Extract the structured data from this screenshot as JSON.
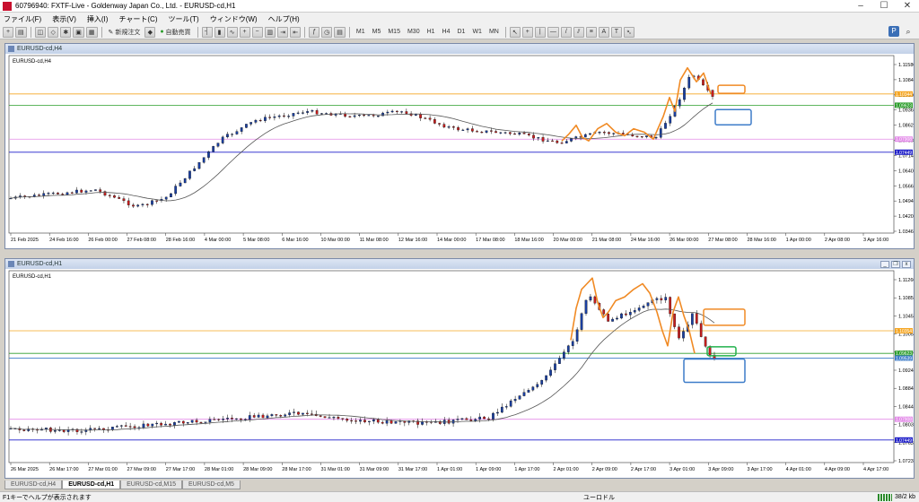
{
  "app": {
    "window_title": "60796940: FXTF-Live - Goldenway Japan Co., Ltd. - EURUSD-cd,H1"
  },
  "menu": [
    "ファイル(F)",
    "表示(V)",
    "挿入(I)",
    "チャート(C)",
    "ツール(T)",
    "ウィンドウ(W)",
    "ヘルプ(H)"
  ],
  "toolbar": {
    "new_order": "新規注文",
    "auto_trade": "自動売買",
    "timeframes": [
      "M1",
      "M5",
      "M15",
      "M30",
      "H1",
      "H4",
      "D1",
      "W1",
      "MN"
    ]
  },
  "colors": {
    "orange_line": "#f5a623",
    "violet_line": "#e38ce8",
    "blue_line": "#1f1fc9",
    "green_line": "#2a9d2a",
    "ma_line": "#555555",
    "bull": "#1a3fa0",
    "bear": "#c81e1e",
    "drawing_orange": "#f08a24",
    "drawing_blue": "#3d7cc9",
    "drawing_green": "#22b14c"
  },
  "chart_h4": {
    "window_label": "EURUSD-cd,H4",
    "symbol_label": "EURUSD-cd,H4",
    "price_labels": [
      "1.11580",
      "1.10840",
      "1.10100",
      "1.09360",
      "1.08620",
      "1.07880",
      "1.07140",
      "1.06400",
      "1.05660",
      "1.04940",
      "1.04200",
      "1.03460"
    ],
    "price_badges": {
      "orange": "1.10344",
      "green": "1.09623",
      "violet": "1.07908",
      "blue": "1.07449"
    },
    "time_labels": [
      "21 Feb 2025",
      "24 Feb 16:00",
      "26 Feb 00:00",
      "27 Feb 08:00",
      "28 Feb 16:00",
      "4 Mar 00:00",
      "5 Mar 08:00",
      "6 Mar 16:00",
      "10 Mar 00:00",
      "11 Mar 08:00",
      "12 Mar 16:00",
      "14 Mar 00:00",
      "17 Mar 08:00",
      "18 Mar 16:00",
      "20 Mar 00:00",
      "21 Mar 08:00",
      "24 Mar 16:00",
      "26 Mar 00:00",
      "27 Mar 08:00",
      "28 Mar 16:00",
      "1 Apr 00:00",
      "2 Apr 08:00",
      "3 Apr 16:00"
    ]
  },
  "chart_h1": {
    "window_label": "EURUSD-cd,H1",
    "symbol_label": "EURUSD-cd,H1",
    "price_labels": [
      "1.11260",
      "1.10850",
      "1.10450",
      "1.10050",
      "1.09640",
      "1.09240",
      "1.08840",
      "1.08440",
      "1.08030",
      "1.07630",
      "1.07230"
    ],
    "price_badges": {
      "orange": "1.10354",
      "green": "1.09623",
      "blue2": "1.09539",
      "violet": "1.07908",
      "blue": "1.07449"
    },
    "time_labels": [
      "26 Mar 2025",
      "26 Mar 17:00",
      "27 Mar 01:00",
      "27 Mar 09:00",
      "27 Mar 17:00",
      "28 Mar 01:00",
      "28 Mar 09:00",
      "28 Mar 17:00",
      "31 Mar 01:00",
      "31 Mar 09:00",
      "31 Mar 17:00",
      "1 Apr 01:00",
      "1 Apr 09:00",
      "1 Apr 17:00",
      "2 Apr 01:00",
      "2 Apr 09:00",
      "2 Apr 17:00",
      "3 Apr 01:00",
      "3 Apr 09:00",
      "3 Apr 17:00",
      "4 Apr 01:00",
      "4 Apr 09:00",
      "4 Apr 17:00"
    ]
  },
  "tabs": [
    "EURUSD-cd,H4",
    "EURUSD-cd,H1",
    "EURUSD-cd,M15",
    "EURUSD-cd,M5"
  ],
  "status": {
    "help_hint": "F1キーでヘルプが表示されます",
    "profile": "ユーロドル",
    "traffic": "38/2 kb"
  }
}
